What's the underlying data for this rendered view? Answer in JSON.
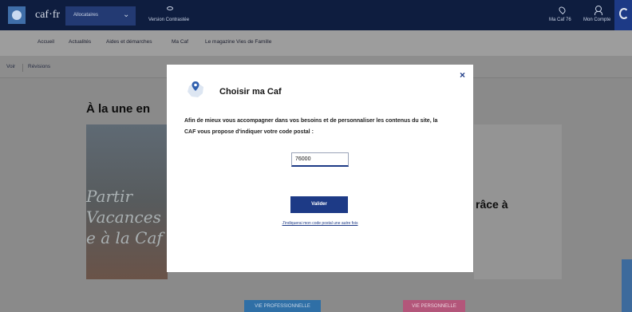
{
  "header": {
    "logo_text": "caf·fr",
    "role_label": "Allocataires",
    "version_label": "Version Contrastée",
    "my_caf_label": "Ma Caf 76",
    "account_label": "Mon Compte"
  },
  "nav": {
    "items": [
      {
        "label": "Accueil"
      },
      {
        "label": "Actualités"
      },
      {
        "label": "Aides et démarches"
      },
      {
        "label": "Ma Caf"
      },
      {
        "label": "Le magazine Vies de Famille"
      }
    ]
  },
  "breadcrumb": {
    "items": [
      {
        "label": "Voir"
      },
      {
        "label": "Révisions"
      }
    ]
  },
  "background": {
    "une_title": "À la une en",
    "card_image_lines": [
      "Partir",
      "Vacances",
      "e à la Caf"
    ],
    "card_right_text": "râce à",
    "btn_pro": "VIE PROFESSIONNELLE",
    "btn_perso": "VIE PERSONNELLE"
  },
  "modal": {
    "title": "Choisir ma Caf",
    "description": "Afin de mieux vous accompagner dans vos besoins et de personnaliser les contenus du site, la CAF vous propose d'indiquer votre code postal :",
    "postal_value": "76000",
    "submit_label": "Valider",
    "later_link": "J'indiquerai mon code postal une autre fois",
    "close_symbol": "×"
  },
  "colors": {
    "brand_navy": "#0e1d3f",
    "primary_blue": "#1d3a86",
    "pro_button": "#2f6fa6",
    "perso_button": "#b3567a"
  },
  "icons": {
    "close": "close-icon",
    "map": "france-map-pin-icon",
    "eye": "eye-icon",
    "location": "location-pin-icon",
    "user": "user-icon",
    "search": "search-icon",
    "chevron": "chevron-down-icon"
  }
}
